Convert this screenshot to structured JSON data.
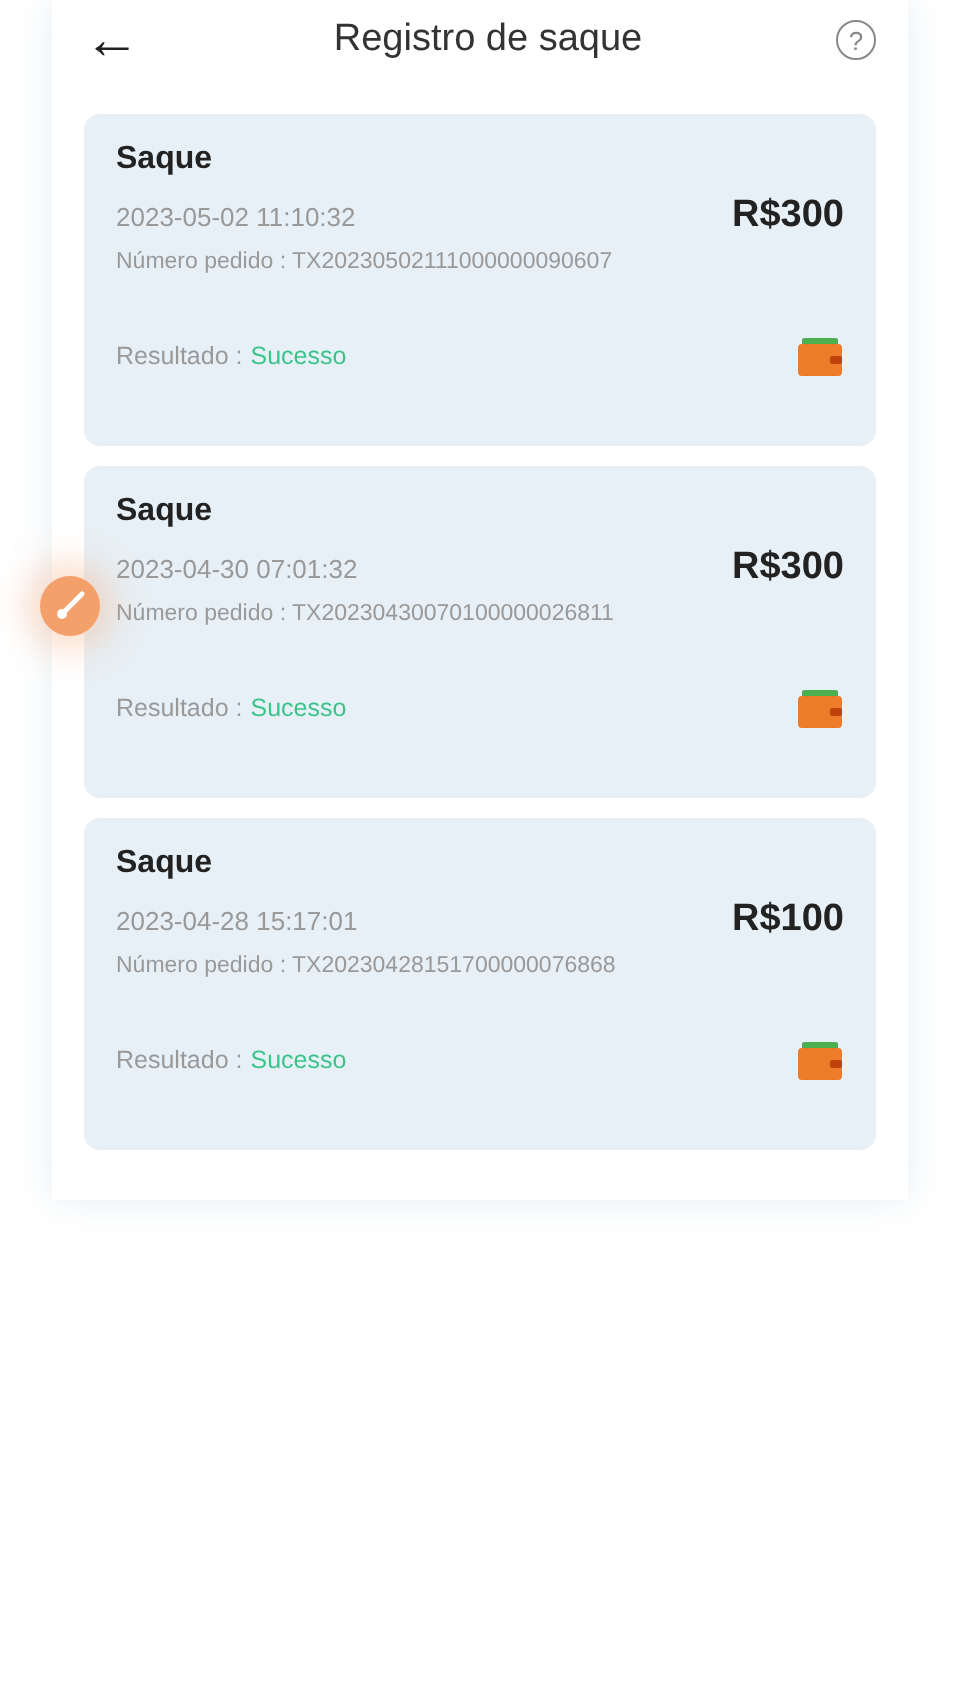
{
  "header": {
    "back_icon": "←",
    "title": "Registro de saque",
    "help_icon": "?"
  },
  "records": [
    {
      "type": "Saque",
      "datetime": "2023-05-02 11:10:32",
      "amount": "R$300",
      "order_label": "Número pedido : TX20230502111000000090607",
      "result_label": "Resultado :",
      "result": "Sucesso",
      "color": "#3cc48a"
    },
    {
      "type": "Saque",
      "datetime": "2023-04-30 07:01:32",
      "amount": "R$300",
      "order_label": "Número pedido : TX20230430070100000026811",
      "result_label": "Resultado :",
      "result": "Sucesso",
      "color": "#3cc48a"
    },
    {
      "type": "Saque",
      "datetime": "2023-04-28 15:17:01",
      "amount": "R$100",
      "order_label": "Número pedido : TX20230428151700000076868",
      "result_label": "Resultado :",
      "result": "Sucesso",
      "color": "#3cc48a"
    }
  ]
}
